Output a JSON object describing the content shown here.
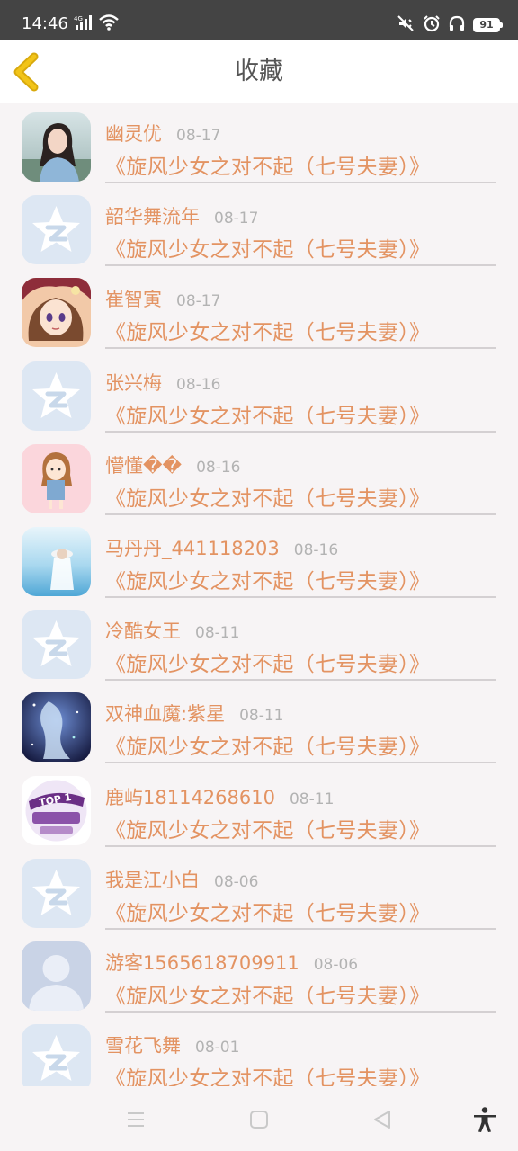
{
  "status_bar": {
    "time": "14:46",
    "network": "4G",
    "battery": "91",
    "icons": [
      "signal-icon",
      "wifi-icon",
      "mute-vibrate-icon",
      "alarm-icon",
      "headphones-icon",
      "battery-icon"
    ]
  },
  "header": {
    "title": "收藏",
    "back_icon": "chevron-left-icon"
  },
  "colors": {
    "accent": "#e39362",
    "back_arrow": "#f2c418",
    "date": "#b3b3b3",
    "divider": "#d4d0d2",
    "background": "#f7f4f5"
  },
  "favorites": [
    {
      "user": "幽灵优",
      "date": "08-17",
      "title": "《旋风少女之对不起（七号夫妻）》",
      "avatar": "photo-girl-avatar"
    },
    {
      "user": "韶华舞流年",
      "date": "08-17",
      "title": "《旋风少女之对不起（七号夫妻）》",
      "avatar": "qq-star-default-avatar"
    },
    {
      "user": "崔智寅",
      "date": "08-17",
      "title": "《旋风少女之对不起（七号夫妻）》",
      "avatar": "anime-girl-avatar"
    },
    {
      "user": "张兴梅",
      "date": "08-16",
      "title": "《旋风少女之对不起（七号夫妻）》",
      "avatar": "qq-star-default-avatar"
    },
    {
      "user": "懵懂��",
      "date": "08-16",
      "title": "《旋风少女之对不起（七号夫妻）》",
      "avatar": "cartoon-girl-avatar"
    },
    {
      "user": "马丹丹_441118203",
      "date": "08-16",
      "title": "《旋风少女之对不起（七号夫妻）》",
      "avatar": "beach-girl-avatar"
    },
    {
      "user": "冷酷女王",
      "date": "08-11",
      "title": "《旋风少女之对不起（七号夫妻）》",
      "avatar": "qq-star-default-avatar"
    },
    {
      "user": "双神血魔:紫星",
      "date": "08-11",
      "title": "《旋风少女之对不起（七号夫妻）》",
      "avatar": "fantasy-art-avatar"
    },
    {
      "user": "鹿屿18114268610",
      "date": "08-11",
      "title": "《旋风少女之对不起（七号夫妻）》",
      "avatar": "top1-badge-avatar",
      "avatar_text": "TOP 1"
    },
    {
      "user": "我是江小白",
      "date": "08-06",
      "title": "《旋风少女之对不起（七号夫妻）》",
      "avatar": "qq-star-default-avatar"
    },
    {
      "user": "游客1565618709911",
      "date": "08-06",
      "title": "《旋风少女之对不起（七号夫妻）》",
      "avatar": "silhouette-default-avatar"
    },
    {
      "user": "雪花飞舞",
      "date": "08-01",
      "title": "《旋风少女之对不起（七号夫妻）》",
      "avatar": "qq-star-default-avatar"
    }
  ],
  "nav_bar": {
    "buttons": [
      "menu-icon",
      "home-icon",
      "back-triangle-icon",
      "accessibility-icon"
    ]
  }
}
